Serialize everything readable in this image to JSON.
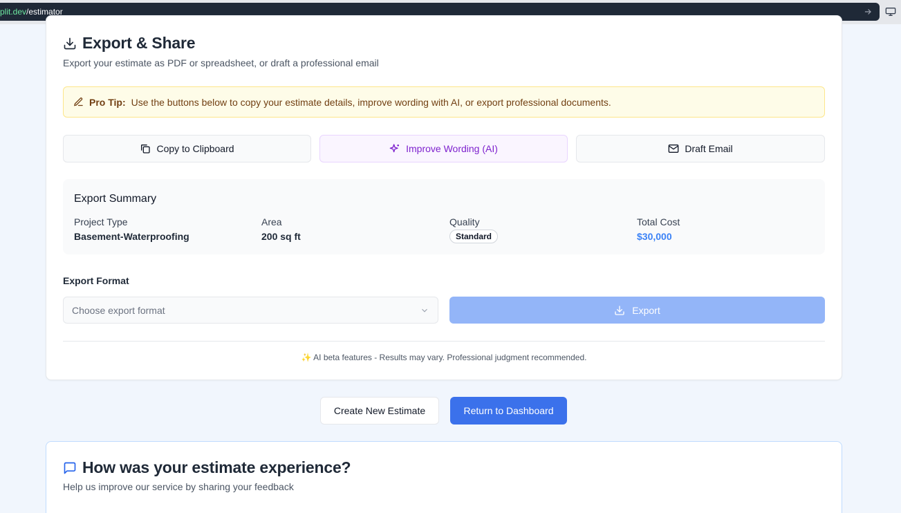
{
  "browser": {
    "url_host": "plit.dev",
    "url_path": "/estimator"
  },
  "export_card": {
    "title": "Export & Share",
    "subtitle": "Export your estimate as PDF or spreadsheet, or draft a professional email",
    "tip_label": "Pro Tip:",
    "tip_text": "Use the buttons below to copy your estimate details, improve wording with AI, or export professional documents.",
    "actions": {
      "copy": "Copy to Clipboard",
      "improve": "Improve Wording (AI)",
      "email": "Draft Email"
    },
    "summary": {
      "title": "Export Summary",
      "project_type_label": "Project Type",
      "project_type_value": "Basement-Waterproofing",
      "area_label": "Area",
      "area_value": "200 sq ft",
      "quality_label": "Quality",
      "quality_value": "Standard",
      "total_label": "Total Cost",
      "total_value": "$30,000"
    },
    "format_label": "Export Format",
    "format_placeholder": "Choose export format",
    "export_button": "Export",
    "ai_note": "✨ AI beta features - Results may vary. Professional judgment recommended."
  },
  "bottom_actions": {
    "create_new": "Create New Estimate",
    "return_dashboard": "Return to Dashboard"
  },
  "feedback_card": {
    "title": "How was your estimate experience?",
    "subtitle": "Help us improve our service by sharing your feedback"
  },
  "colors": {
    "primary": "#3b71eb",
    "export_disabled": "#93b5f8",
    "ai_purple": "#7e22ce",
    "tip_bg": "#fefce8",
    "total_blue": "#3b82f6"
  }
}
